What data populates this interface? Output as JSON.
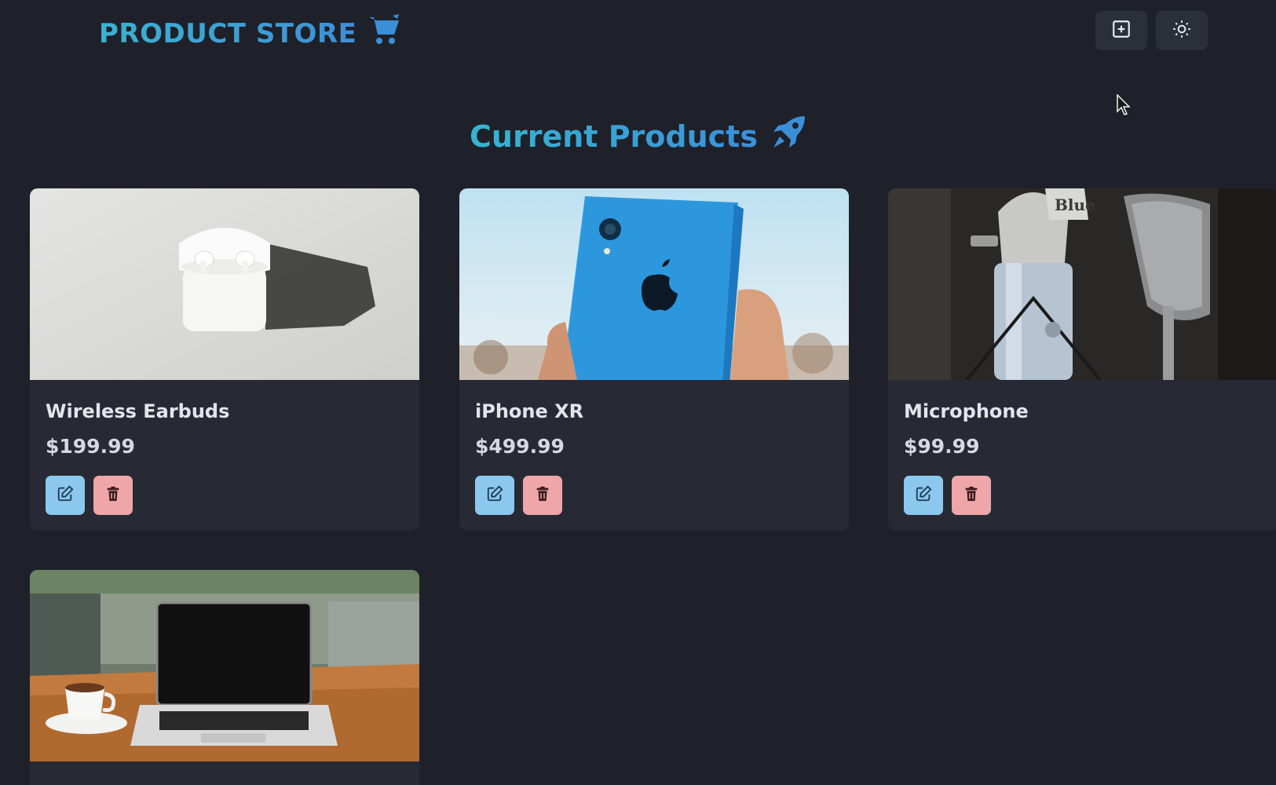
{
  "navbar": {
    "brand": "PRODUCT STORE",
    "brand_icon": "cart-icon",
    "create_icon": "plus-square-icon",
    "theme_icon": "sun-icon"
  },
  "main": {
    "title": "Current Products",
    "title_icon": "rocket-icon"
  },
  "products": [
    {
      "name": "Wireless Earbuds",
      "price": "$199.99",
      "image": "earbuds-image"
    },
    {
      "name": "iPhone XR",
      "price": "$499.99",
      "image": "iphone-image"
    },
    {
      "name": "Microphone",
      "price": "$99.99",
      "image": "microphone-image"
    },
    {
      "name": "",
      "price": "",
      "image": "laptop-image"
    }
  ],
  "colors": {
    "background": "#1e212a",
    "card": "#272a35",
    "accent": "#3aa3d3",
    "edit_button": "#8cc8ee",
    "delete_button": "#eea6a9"
  }
}
